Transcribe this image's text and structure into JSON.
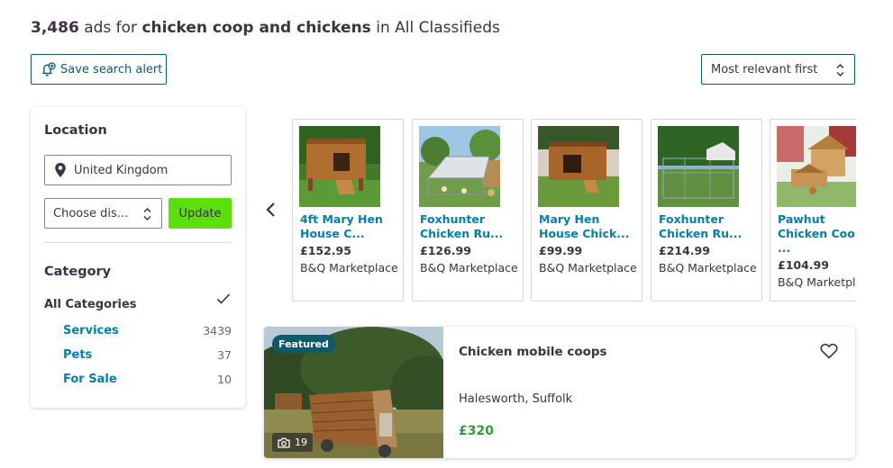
{
  "header": {
    "count": "3,486",
    "ads_for": "ads for",
    "query": "chicken coop and chickens",
    "in": "in",
    "scope": "All Classifieds"
  },
  "toolbar": {
    "save_alert_label": "Save search alert",
    "sort_value": "Most relevant first"
  },
  "filters": {
    "location_title": "Location",
    "location_value": "United Kingdom",
    "distance_value": "Choose dis...",
    "update_label": "Update",
    "category_title": "Category",
    "all_categories_label": "All Categories",
    "categories": [
      {
        "name": "Services",
        "count": "3439"
      },
      {
        "name": "Pets",
        "count": "37"
      },
      {
        "name": "For Sale",
        "count": "10"
      }
    ]
  },
  "carousel": {
    "items": [
      {
        "title": "4ft Mary Hen\nHouse C...",
        "price": "£152.95",
        "seller": "B&Q Marketplace"
      },
      {
        "title": "Foxhunter\nChicken Ru...",
        "price": "£126.99",
        "seller": "B&Q Marketplace"
      },
      {
        "title": "Mary Hen\nHouse Chick...",
        "price": "£99.99",
        "seller": "B&Q Marketplace"
      },
      {
        "title": "Foxhunter\nChicken Ru...",
        "price": "£214.99",
        "seller": "B&Q Marketplace"
      },
      {
        "title": "Pawhut\nChicken Coop\n...",
        "price": "£104.99",
        "seller": "B&Q Marketplace"
      }
    ]
  },
  "listing": {
    "badge": "Featured",
    "photo_count": "19",
    "title": "Chicken mobile coops",
    "location": "Halesworth, Suffolk",
    "price": "£320"
  },
  "colors": {
    "brand_teal": "#0e5a6d",
    "link_blue": "#007fb0",
    "update_green": "#5ce00b",
    "price_green": "#2e9e3d",
    "text": "#3c3241"
  },
  "icons": {
    "save_alert": "bell-plus-icon",
    "sort": "up-down-arrows-icon",
    "location": "map-pin-icon",
    "selected": "checkmark-icon",
    "prev": "chevron-left-icon",
    "photos": "camera-icon",
    "favourite": "heart-icon"
  }
}
